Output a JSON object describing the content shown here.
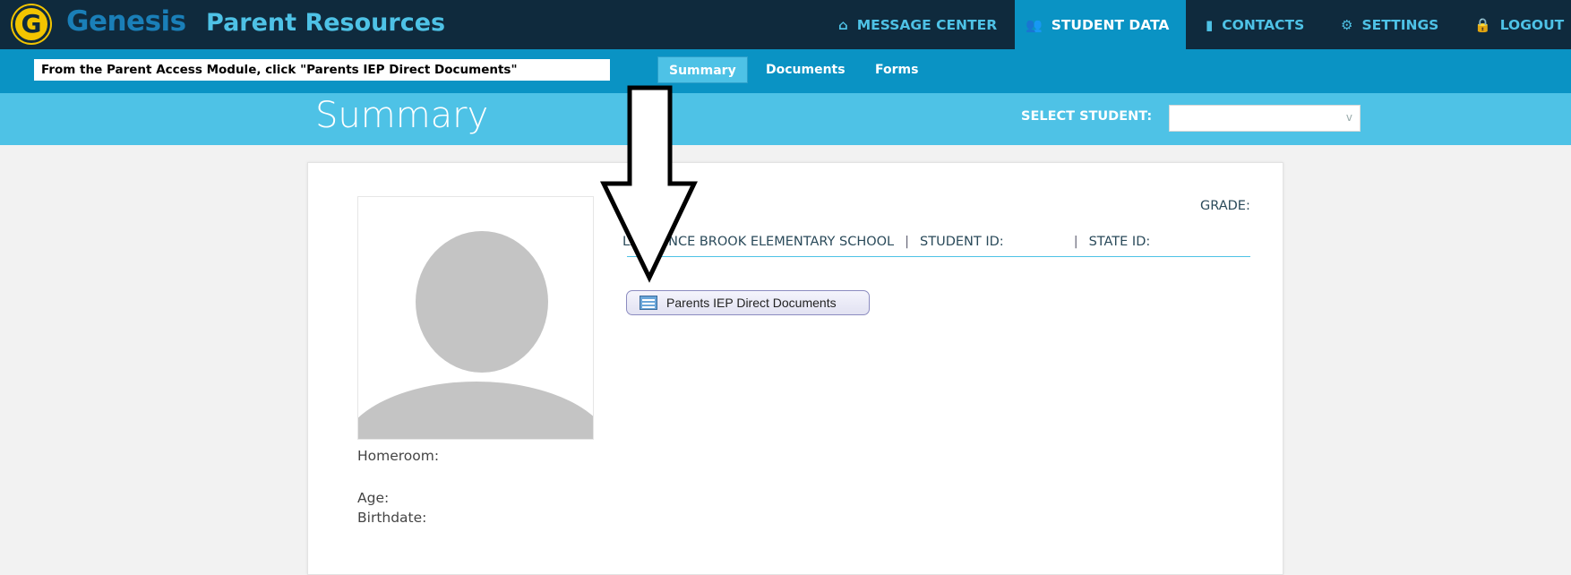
{
  "header": {
    "logo_letter": "G",
    "brand": "Genesis",
    "product": "Parent Resources"
  },
  "topnav": [
    {
      "icon": "home-icon",
      "glyph": "⌂",
      "label": "MESSAGE CENTER"
    },
    {
      "icon": "users-icon",
      "glyph": "👥",
      "label": "STUDENT DATA"
    },
    {
      "icon": "contacts-icon",
      "glyph": "▮",
      "label": "CONTACTS"
    },
    {
      "icon": "gear-icon",
      "glyph": "⚙",
      "label": "SETTINGS"
    },
    {
      "icon": "lock-icon",
      "glyph": "🔒",
      "label": "LOGOUT"
    }
  ],
  "callout": "From the Parent Access Module, click \"Parents IEP Direct Documents\"",
  "subnav": [
    "Summary",
    "Documents",
    "Forms"
  ],
  "page": {
    "title": "Summary",
    "select_label": "SELECT STUDENT:",
    "select_value": "",
    "select_chevron": "v"
  },
  "student": {
    "grade_label": "GRADE:",
    "school": "LAWRENCE BROOK ELEMENTARY SCHOOL",
    "sep": "|",
    "student_id_label": "STUDENT ID:",
    "state_id_label": "STATE ID:",
    "homeroom_label": "Homeroom:",
    "age_label": "Age:",
    "birthdate_label": "Birthdate:"
  },
  "iep_button": "Parents IEP Direct Documents",
  "colors": {
    "topbar": "#0f2a3d",
    "subnav": "#0a93c4",
    "titlebar": "#4ec2e6",
    "accent_yellow": "#f2c400"
  }
}
